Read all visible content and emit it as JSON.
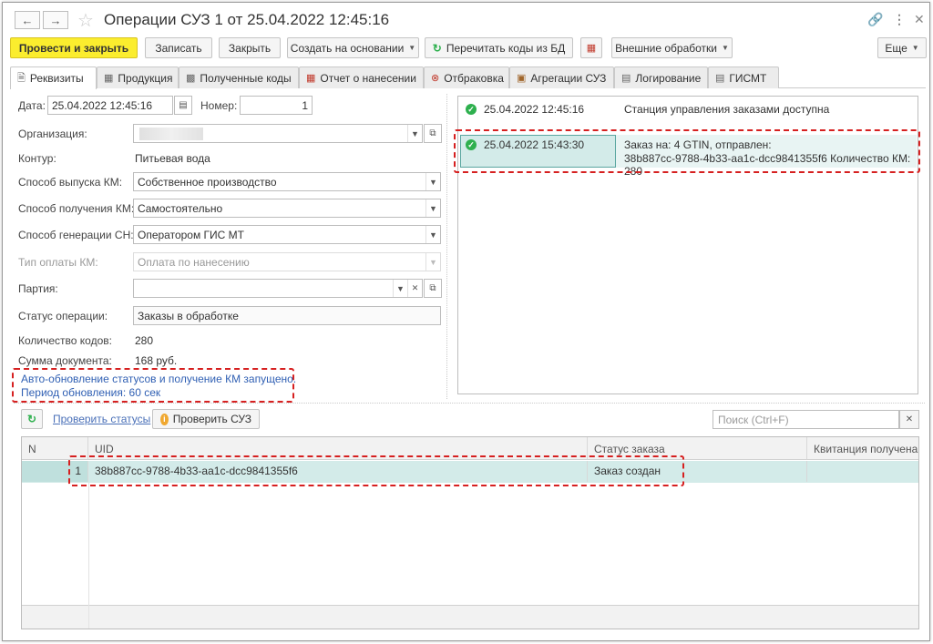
{
  "window": {
    "title": "Операции СУЗ 1 от 25.04.2022 12:45:16",
    "link_icon": "link-icon",
    "more_icon": "kebab-icon",
    "close_icon": "close-icon"
  },
  "toolbar": {
    "post_close": "Провести и закрыть",
    "write": "Записать",
    "close": "Закрыть",
    "create_based": "Создать на основании",
    "reread_codes": "Перечитать коды из БД",
    "external": "Внешние обработки",
    "more": "Еще"
  },
  "tabs": [
    {
      "label": "Реквизиты",
      "icon": "document-icon",
      "active": true
    },
    {
      "label": "Продукция",
      "icon": "table-icon"
    },
    {
      "label": "Полученные коды",
      "icon": "qr-icon"
    },
    {
      "label": "Отчет о нанесении",
      "icon": "report-icon"
    },
    {
      "label": "Отбраковка",
      "icon": "reject-icon"
    },
    {
      "label": "Агрегации СУЗ",
      "icon": "box-icon"
    },
    {
      "label": "Логирование",
      "icon": "log-icon"
    },
    {
      "label": "ГИСМТ",
      "icon": "gismt-icon"
    }
  ],
  "form": {
    "date_label": "Дата:",
    "date_value": "25.04.2022 12:45:16",
    "number_label": "Номер:",
    "number_value": "1",
    "org_label": "Организация:",
    "contour_label": "Контур:",
    "contour_value": "Питьевая вода",
    "release_label": "Способ выпуска КМ:",
    "release_value": "Собственное производство",
    "receive_label": "Способ получения КМ:",
    "receive_value": "Самостоятельно",
    "gen_label": "Способ генерации СН:",
    "gen_value": "Оператором ГИС МТ",
    "pay_label": "Тип оплаты КМ:",
    "pay_value": "Оплата по нанесению",
    "batch_label": "Партия:",
    "batch_value": "",
    "status_label": "Статус операции:",
    "status_value": "Заказы в обработке",
    "count_label": "Количество кодов:",
    "count_value": "280",
    "sum_label": "Сумма документа:",
    "sum_value": "168 руб.",
    "note_line1": "Авто-обновление статусов и получение КМ запущено.",
    "note_line2": "Период обновления: 60 сек"
  },
  "log": [
    {
      "time": "25.04.2022 12:45:16",
      "text": "Станция управления заказами доступна"
    },
    {
      "time": "25.04.2022 15:43:30",
      "text1": "Заказ на: 4 GTIN, отправлен:",
      "text2": "38b887cc-9788-4b33-aa1c-dcc9841355f6 Количество КМ: 280"
    }
  ],
  "bottom_toolbar": {
    "check_statuses": "Проверить статусы",
    "check_suz": "Проверить СУЗ",
    "search_placeholder": "Поиск (Ctrl+F)"
  },
  "table": {
    "columns": [
      "N",
      "UID",
      "Статус заказа",
      "Квитанция получена"
    ],
    "rows": [
      {
        "n": "1",
        "uid": "38b887cc-9788-4b33-aa1c-dcc9841355f6",
        "status": "Заказ создан",
        "receipt": ""
      }
    ]
  },
  "colors": {
    "primary_button": "#fbed2e",
    "selected_row": "#d3ebe9",
    "highlight": "#d62020",
    "link": "#2f5fb3",
    "ok": "#2eb04e"
  }
}
